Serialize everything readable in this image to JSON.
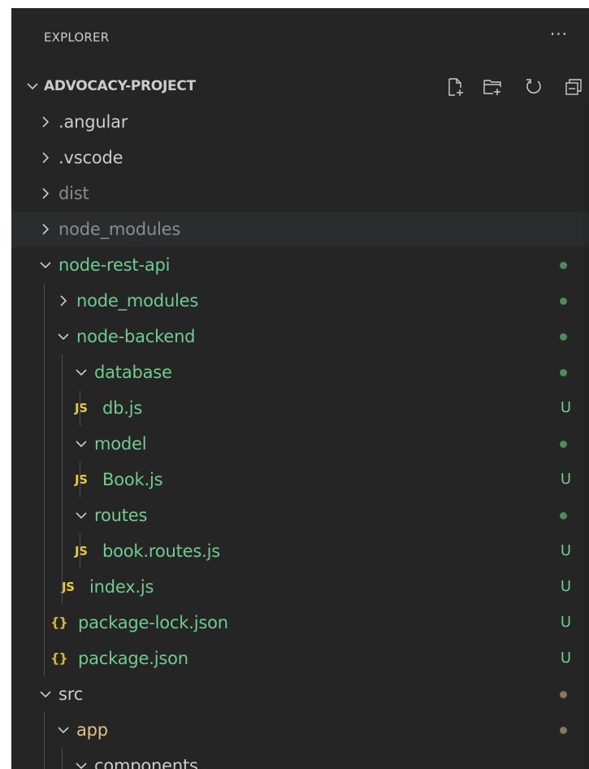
{
  "explorer": {
    "title": "EXPLORER",
    "more_label": "···"
  },
  "section": {
    "title": "ADVOCACY-PROJECT",
    "actions": [
      {
        "icon": "new-file-icon"
      },
      {
        "icon": "new-folder-icon"
      },
      {
        "icon": "refresh-icon"
      },
      {
        "icon": "collapse-all-icon"
      }
    ]
  },
  "colors": {
    "untracked": "#73c991",
    "modified": "#e2c08d",
    "dim": "#8b8b8b",
    "normal": "#cccccc",
    "js_icon": "#e8c93a"
  },
  "tree": [
    {
      "label": ".angular",
      "kind": "folder",
      "expanded": false,
      "depth": 0,
      "color": "normal"
    },
    {
      "label": ".vscode",
      "kind": "folder",
      "expanded": false,
      "depth": 0,
      "color": "normal"
    },
    {
      "label": "dist",
      "kind": "folder",
      "expanded": false,
      "depth": 0,
      "color": "dim"
    },
    {
      "label": "node_modules",
      "kind": "folder",
      "expanded": false,
      "depth": 0,
      "color": "dim",
      "hover": true
    },
    {
      "label": "node-rest-api",
      "kind": "folder",
      "expanded": true,
      "depth": 0,
      "color": "green",
      "status": "dot"
    },
    {
      "label": "node_modules",
      "kind": "folder",
      "expanded": false,
      "depth": 1,
      "color": "green",
      "status": "dot"
    },
    {
      "label": "node-backend",
      "kind": "folder",
      "expanded": true,
      "depth": 1,
      "color": "green",
      "status": "dot"
    },
    {
      "label": "database",
      "kind": "folder",
      "expanded": true,
      "depth": 2,
      "color": "green",
      "status": "dot"
    },
    {
      "label": "db.js",
      "kind": "js",
      "depth": 3,
      "color": "green",
      "status": "U",
      "icon_text": "JS"
    },
    {
      "label": "model",
      "kind": "folder",
      "expanded": true,
      "depth": 2,
      "color": "green",
      "status": "dot"
    },
    {
      "label": "Book.js",
      "kind": "js",
      "depth": 3,
      "color": "green",
      "status": "U",
      "icon_text": "JS"
    },
    {
      "label": "routes",
      "kind": "folder",
      "expanded": true,
      "depth": 2,
      "color": "green",
      "status": "dot"
    },
    {
      "label": "book.routes.js",
      "kind": "js",
      "depth": 3,
      "color": "green",
      "status": "U",
      "icon_text": "JS"
    },
    {
      "label": "index.js",
      "kind": "js",
      "depth": 2,
      "color": "green",
      "status": "U",
      "icon_text": "JS"
    },
    {
      "label": "package-lock.json",
      "kind": "json",
      "depth": 1,
      "color": "green",
      "status": "U",
      "icon_text": "{}"
    },
    {
      "label": "package.json",
      "kind": "json",
      "depth": 1,
      "color": "green",
      "status": "U",
      "icon_text": "{}"
    },
    {
      "label": "src",
      "kind": "folder",
      "expanded": true,
      "depth": 0,
      "color": "normal",
      "status": "dot-modified"
    },
    {
      "label": "app",
      "kind": "folder",
      "expanded": true,
      "depth": 1,
      "color": "orange",
      "status": "dot-modified"
    },
    {
      "label": "components",
      "kind": "folder",
      "expanded": true,
      "depth": 2,
      "color": "normal"
    }
  ]
}
